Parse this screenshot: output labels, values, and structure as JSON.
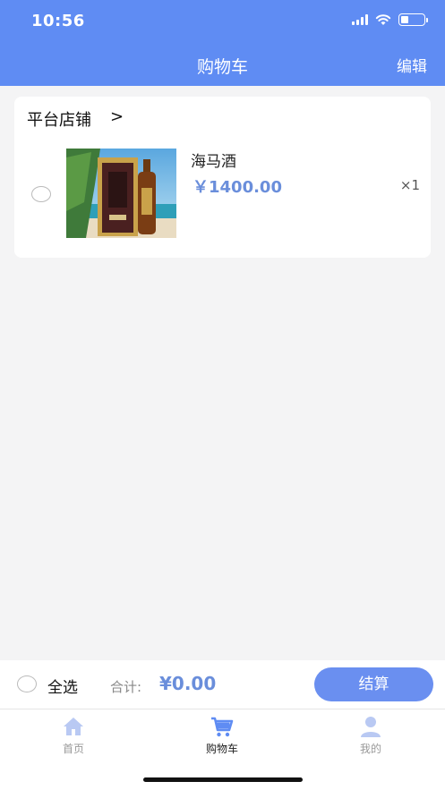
{
  "status_bar": {
    "time": "10:56"
  },
  "header": {
    "title": "购物车",
    "edit_label": "编辑"
  },
  "store": {
    "name": "平台店铺",
    "chevron": ">",
    "items": [
      {
        "name": "海马酒",
        "price": "￥1400.00",
        "quantity": "×1"
      }
    ]
  },
  "footer": {
    "select_all_label": "全选",
    "total_label": "合计:",
    "total_value": "¥0.00",
    "checkout_label": "结算"
  },
  "tabbar": {
    "tabs": [
      {
        "label": "首页",
        "icon": "home-icon",
        "active": false
      },
      {
        "label": "购物车",
        "icon": "cart-icon",
        "active": true
      },
      {
        "label": "我的",
        "icon": "user-icon",
        "active": false
      }
    ]
  },
  "colors": {
    "primary": "#5f8cf3",
    "price": "#6a8edb",
    "background": "#f4f4f5"
  }
}
